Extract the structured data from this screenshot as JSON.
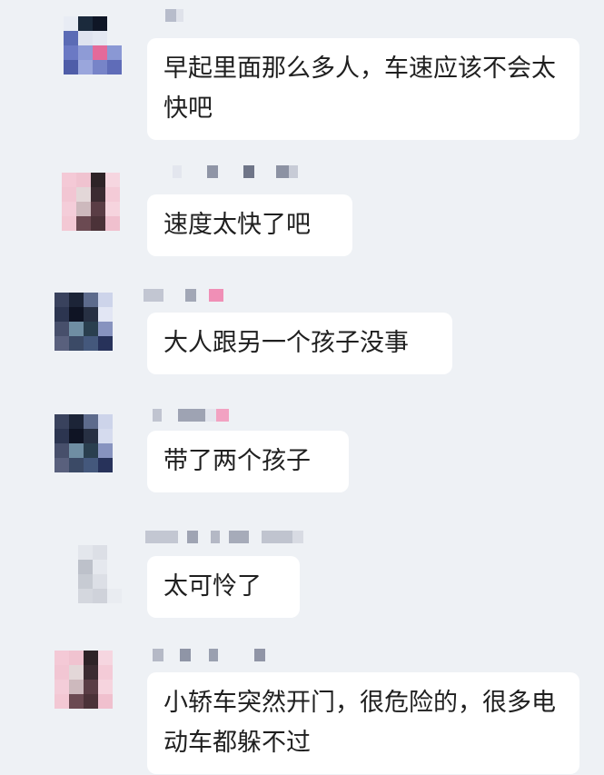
{
  "colors": {
    "background": "#eef1f5",
    "bubble": "#ffffff",
    "text": "#1f1f1f"
  },
  "messages": [
    {
      "text": "早起里面那么多人，车速应该不会太快吧"
    },
    {
      "text": "速度太快了吧"
    },
    {
      "text": "大人跟另一个孩子没事"
    },
    {
      "text": "带了两个孩子"
    },
    {
      "text": "太可怜了"
    },
    {
      "text": "小轿车突然开门，很危险的，很多电动车都躲不过"
    }
  ]
}
